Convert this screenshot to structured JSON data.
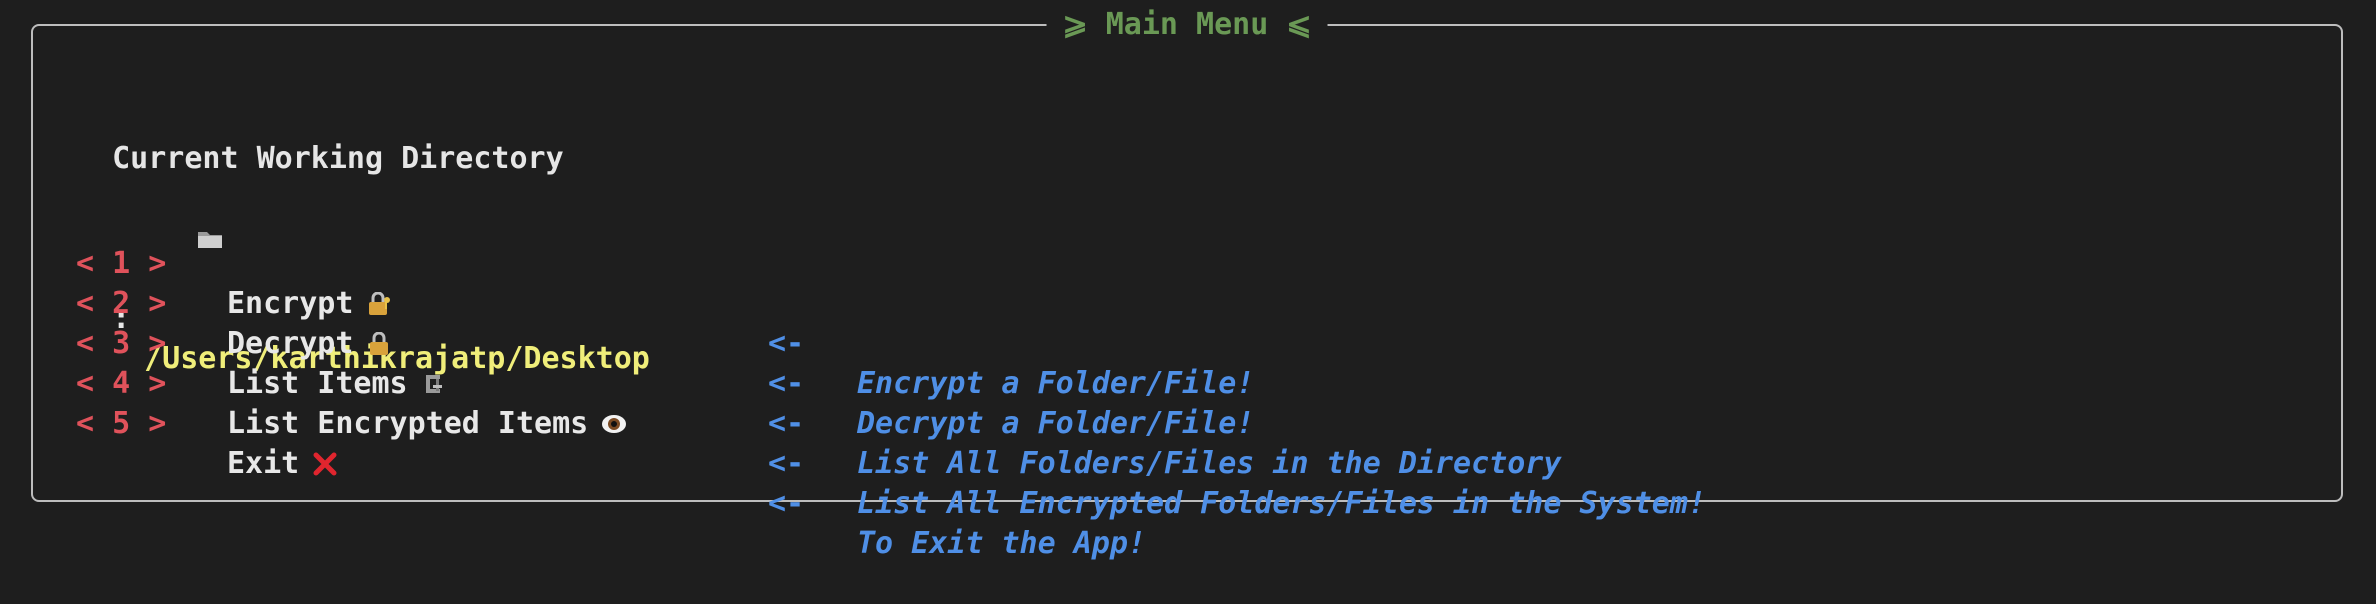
{
  "panel": {
    "title": "⩾ Main Menu ⩽"
  },
  "cwd": {
    "label": "Current Working Directory",
    "separator": ":",
    "path": "/Users/karthikrajatp/Desktop",
    "icon": "folder-icon"
  },
  "menu": {
    "items": [
      {
        "number": "< 1 >",
        "label": "Encrypt",
        "icon": "lock-with-key-icon",
        "arrow": "<-",
        "description": "Encrypt a Folder/File!"
      },
      {
        "number": "< 2 >",
        "label": "Decrypt",
        "icon": "lock-icon",
        "arrow": "<-",
        "description": "Decrypt a Folder/File!"
      },
      {
        "number": "< 3 >",
        "label": "List Items",
        "icon": "clamp-icon",
        "arrow": "<-",
        "description": "List All Folders/Files in the Directory"
      },
      {
        "number": "< 4 >",
        "label": "List Encrypted Items",
        "icon": "eye-icon",
        "arrow": "<-",
        "description": "List All Encrypted Folders/Files in the System!"
      },
      {
        "number": "< 5 >",
        "label": "Exit",
        "icon": "cross-mark-icon",
        "arrow": "<-",
        "description": "To Exit the App!"
      }
    ]
  },
  "colors": {
    "background": "#1e1e1e",
    "border": "#bdbdbd",
    "title": "#6a9955",
    "path": "#f0ee7a",
    "number": "#e0525b",
    "description": "#4f8fe6"
  }
}
